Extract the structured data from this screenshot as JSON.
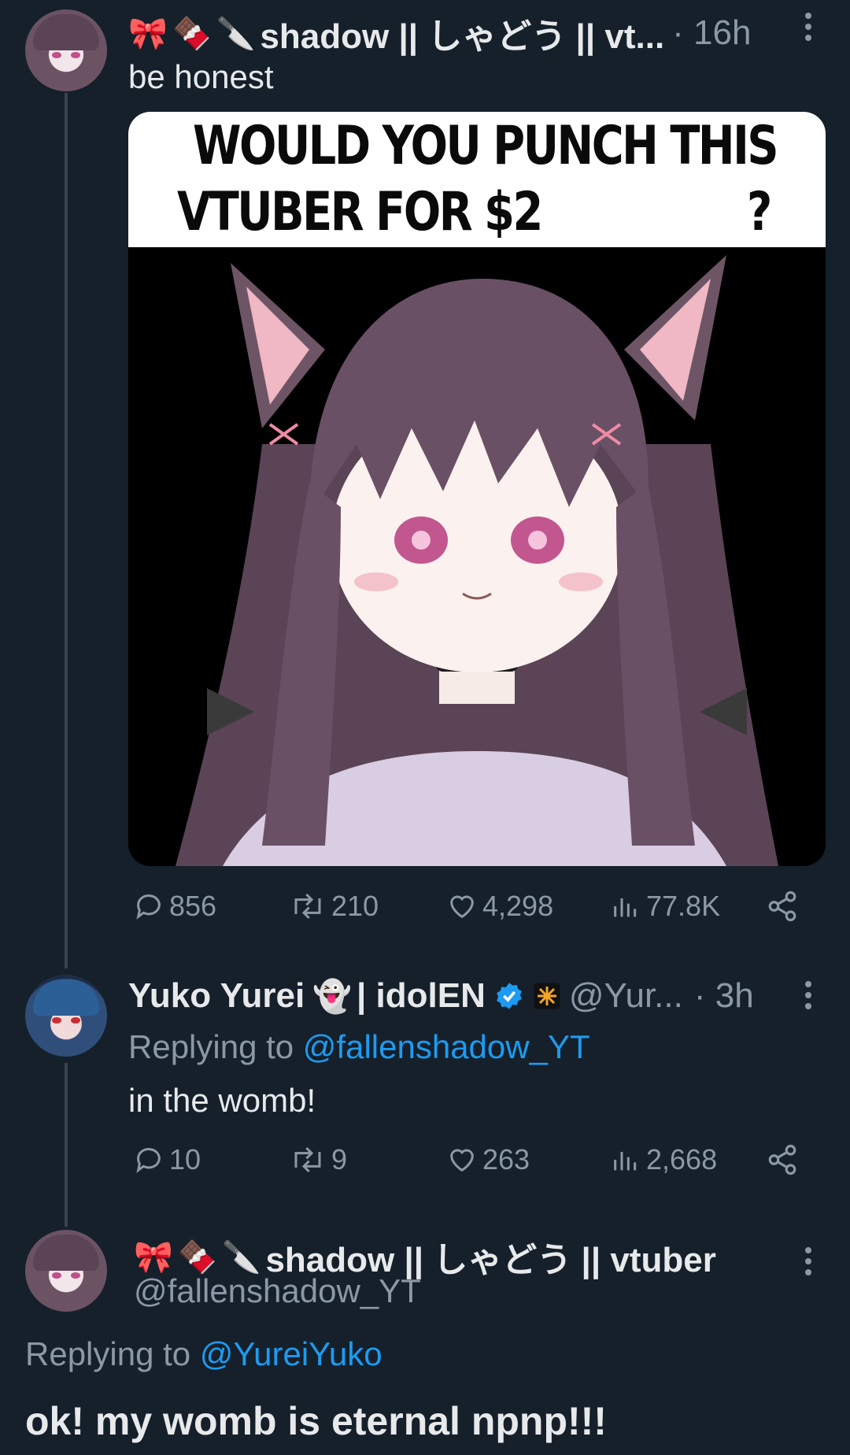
{
  "tweet": {
    "avatar_icon": "user-avatar-icon",
    "emojis": [
      "🎀",
      "🍫",
      "🔪"
    ],
    "name": "shadow || しゃどう || vt...",
    "time": "· 16h",
    "text": "be honest",
    "image_caption_line1": "WOULD YOU PUNCH THIS",
    "image_caption_line2": "VTUBER FOR $2",
    "image_caption_qmark": "?",
    "stats": {
      "replies": "856",
      "retweets": "210",
      "likes": "4,298",
      "views": "77.8K"
    }
  },
  "reply": {
    "name": "Yuko Yurei",
    "name_emoji": "👻",
    "name_suffix": "| idolEN",
    "verified_icon": "verified-badge-icon",
    "handle": "@Yur...",
    "time": "· 3h",
    "replying_prefix": "Replying to",
    "replying_handle": "@fallenshadow_YT",
    "text": "in the womb!",
    "stats": {
      "replies": "10",
      "retweets": "9",
      "likes": "263",
      "views": "2,668"
    }
  },
  "focus_reply": {
    "emojis": [
      "🎀",
      "🍫",
      "🔪"
    ],
    "name": "shadow || しゃどう || vtuber",
    "handle": "@fallenshadow_YT",
    "replying_prefix": "Replying to",
    "replying_handle": "@YureiYuko",
    "text": "ok! my womb is eternal npnp!!!"
  },
  "colors": {
    "background": "#15202b",
    "text": "#e7e9ea",
    "muted": "#8b98a5",
    "link": "#1d9bf0",
    "line": "#38444d"
  }
}
